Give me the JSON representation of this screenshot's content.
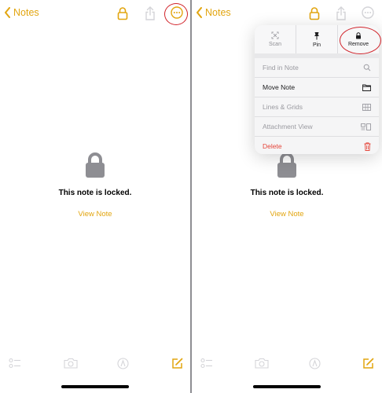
{
  "screens": [
    {
      "nav": {
        "back_label": "Notes"
      },
      "locked_message": "This note is locked.",
      "view_note_label": "View Note"
    },
    {
      "nav": {
        "back_label": "Notes"
      },
      "locked_message": "This note is locked.",
      "view_note_label": "View Note",
      "menu": {
        "quick_actions": [
          {
            "label": "Scan",
            "icon": "scan-icon"
          },
          {
            "label": "Pin",
            "icon": "pin-icon"
          },
          {
            "label": "Remove",
            "icon": "lock-icon"
          }
        ],
        "items": [
          {
            "label": "Find in Note",
            "icon": "search-icon"
          },
          {
            "label": "Move Note",
            "icon": "folder-icon"
          },
          {
            "label": "Lines & Grids",
            "icon": "grid-icon"
          },
          {
            "label": "Attachment View",
            "icon": "attachment-view-icon"
          },
          {
            "label": "Delete",
            "icon": "trash-icon"
          }
        ]
      }
    }
  ],
  "colors": {
    "accent": "#e2a50f",
    "danger": "#e5453a",
    "annotation": "#d1232a",
    "lock_gray": "#8e8e93"
  }
}
